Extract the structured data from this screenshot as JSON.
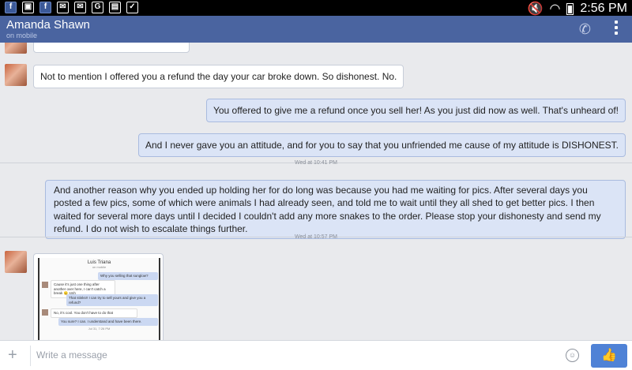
{
  "status_bar": {
    "left_icons": [
      "facebook-app-icon",
      "image-icon",
      "facebook-icon",
      "mail-muted-icon",
      "mail-muted-icon",
      "google-icon",
      "shopping-bag-icon",
      "shopping-bag-check-icon"
    ],
    "left_glyphs": [
      "f",
      "▣",
      "f",
      "✉",
      "✉",
      "G",
      "▤",
      "✓"
    ],
    "time": "2:56 PM"
  },
  "header": {
    "contact_name": "Amanda Shawn",
    "status": "on mobile"
  },
  "messages": [
    {
      "direction": "in",
      "text": "Not to mention I offered you a refund the day your car broke down. So dishonest. No."
    },
    {
      "direction": "out",
      "text": "You offered to give me a refund once you sell her! As you just did now as well. That's unheard of!"
    },
    {
      "direction": "out",
      "text": "And I never gave you an attitude, and for you to say that you unfriended me cause of my attitude is DISHONEST."
    },
    {
      "direction": "out",
      "text": "And another reason why you ended up holding her for do long was because you had me waiting for pics. After several days you posted a few pics, some of which were animals I had already seen, and told me to wait until they all shed to get better pics. I then waited for several more days until I decided I couldn't add any more snakes to the order. Please stop your dishonesty and send my refund. I do not wish to escalate things further."
    }
  ],
  "timestamps": [
    "Wed at 10:41 PM",
    "Wed at 10:57 PM"
  ],
  "attachment": {
    "title": "Luis Triana",
    "subtitle": "on mobile",
    "messages": [
      "Why you selling that sunglow?",
      "Cause it's just one thing after another over here, I can't catch a break 😐 smh",
      "That stinks!! I can try to sell yours and give you a refund?",
      "No, it's cool. You don't have to do that",
      "You sure? I can. I understand and have been there."
    ],
    "date": "Jul 31, 7:26 PM"
  },
  "composer": {
    "placeholder": "Write a message",
    "plus_glyph": "+",
    "emoji_glyph": "☺",
    "like_glyph": "👍"
  },
  "colors": {
    "header_bg": "#4a64a0",
    "outgoing_bubble": "#dbe4f6",
    "like_button": "#4f82d6"
  }
}
